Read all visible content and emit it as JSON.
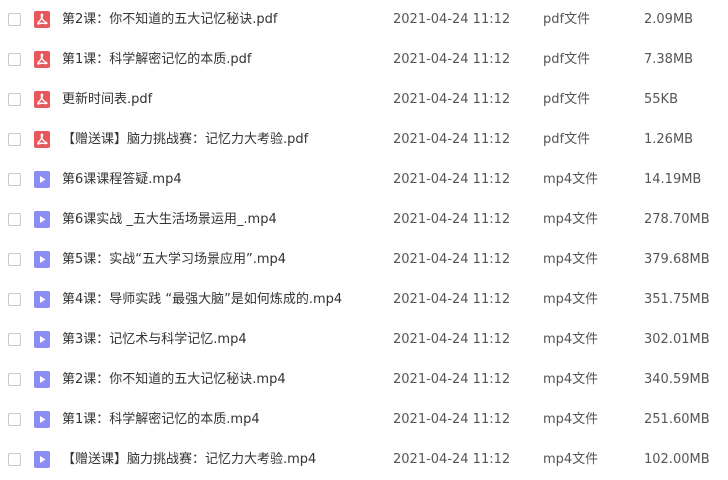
{
  "colors": {
    "pdf_icon": "#e8575c",
    "video_icon": "#8a8ef4",
    "checkbox_border": "#c8c8c8"
  },
  "files": [
    {
      "name": "第2课：你不知道的五大记忆秘诀.pdf",
      "date": "2021-04-24 11:12",
      "type": "pdf文件",
      "size": "2.09MB",
      "icon": "pdf-icon"
    },
    {
      "name": "第1课：科学解密记忆的本质.pdf",
      "date": "2021-04-24 11:12",
      "type": "pdf文件",
      "size": "7.38MB",
      "icon": "pdf-icon"
    },
    {
      "name": "更新时间表.pdf",
      "date": "2021-04-24 11:12",
      "type": "pdf文件",
      "size": "55KB",
      "icon": "pdf-icon"
    },
    {
      "name": "【赠送课】脑力挑战赛：记忆力大考验.pdf",
      "date": "2021-04-24 11:12",
      "type": "pdf文件",
      "size": "1.26MB",
      "icon": "pdf-icon"
    },
    {
      "name": "第6课课程答疑.mp4",
      "date": "2021-04-24 11:12",
      "type": "mp4文件",
      "size": "14.19MB",
      "icon": "video-icon"
    },
    {
      "name": "第6课实战 _五大生活场景运用_.mp4",
      "date": "2021-04-24 11:12",
      "type": "mp4文件",
      "size": "278.70MB",
      "icon": "video-icon"
    },
    {
      "name": "第5课：实战“五大学习场景应用”.mp4",
      "date": "2021-04-24 11:12",
      "type": "mp4文件",
      "size": "379.68MB",
      "icon": "video-icon"
    },
    {
      "name": "第4课：导师实践 “最强大脑”是如何炼成的.mp4",
      "date": "2021-04-24 11:12",
      "type": "mp4文件",
      "size": "351.75MB",
      "icon": "video-icon"
    },
    {
      "name": "第3课：记忆术与科学记忆.mp4",
      "date": "2021-04-24 11:12",
      "type": "mp4文件",
      "size": "302.01MB",
      "icon": "video-icon"
    },
    {
      "name": "第2课：你不知道的五大记忆秘诀.mp4",
      "date": "2021-04-24 11:12",
      "type": "mp4文件",
      "size": "340.59MB",
      "icon": "video-icon"
    },
    {
      "name": "第1课：科学解密记忆的本质.mp4",
      "date": "2021-04-24 11:12",
      "type": "mp4文件",
      "size": "251.60MB",
      "icon": "video-icon"
    },
    {
      "name": "【赠送课】脑力挑战赛：记忆力大考验.mp4",
      "date": "2021-04-24 11:12",
      "type": "mp4文件",
      "size": "102.00MB",
      "icon": "video-icon"
    }
  ]
}
